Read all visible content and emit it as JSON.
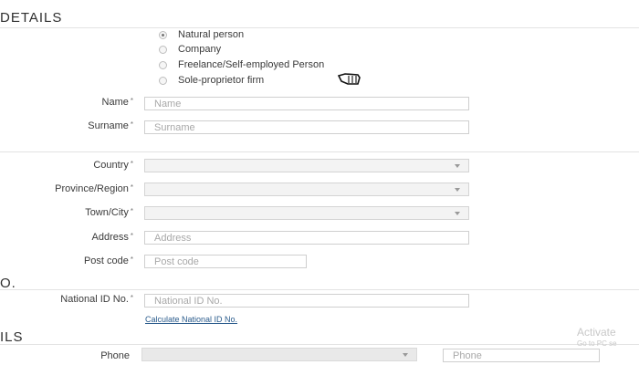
{
  "sections": {
    "details_title": "DETAILS",
    "id_title": "O.",
    "contact_title": "ILS"
  },
  "person_type": {
    "options": [
      {
        "label": "Natural person",
        "checked": true
      },
      {
        "label": "Company",
        "checked": false
      },
      {
        "label": "Freelance/Self-employed Person",
        "checked": false
      },
      {
        "label": "Sole-proprietor firm",
        "checked": false
      }
    ]
  },
  "fields": {
    "name": {
      "label": "Name",
      "placeholder": "Name"
    },
    "surname": {
      "label": "Surname",
      "placeholder": "Surname"
    },
    "country": {
      "label": "Country",
      "value": ""
    },
    "province": {
      "label": "Province/Region",
      "value": ""
    },
    "town": {
      "label": "Town/City",
      "value": ""
    },
    "address": {
      "label": "Address",
      "placeholder": "Address"
    },
    "postcode": {
      "label": "Post code",
      "placeholder": "Post code"
    },
    "national_id": {
      "label": "National ID No.",
      "placeholder": "National ID No."
    },
    "phone": {
      "label": "Phone",
      "placeholder": "Phone"
    }
  },
  "required_mark": "*",
  "links": {
    "calculate_id": "Calculate National ID No."
  },
  "watermark": {
    "line1": "Activate",
    "line2": "Go to PC se"
  },
  "colors": {
    "link": "#2a5b8c",
    "divider": "#e3e3e3"
  }
}
